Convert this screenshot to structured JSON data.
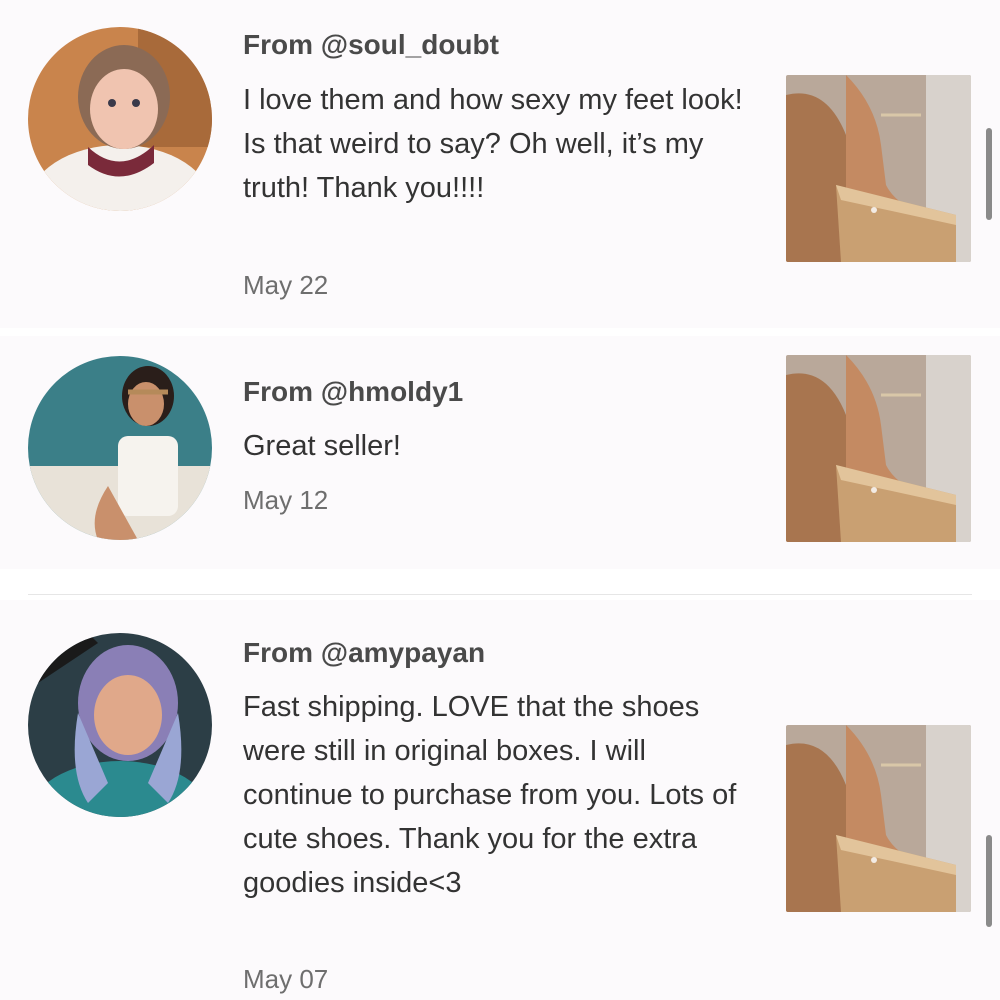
{
  "reviews": [
    {
      "from": "From @soul_doubt",
      "text": "I love them and how sexy my feet look! Is that weird to say? Oh well, it’s my truth! Thank you!!!!",
      "date": "May 22"
    },
    {
      "from": "From @hmoldy1",
      "text": "Great seller!",
      "date": "May 12"
    },
    {
      "from": "From @amypayan",
      "text": "Fast shipping. LOVE that the shoes were still in original boxes. I will continue to purchase from you. Lots of cute shoes. Thank you for the extra goodies inside<3",
      "date": "May 07"
    }
  ],
  "colors": {
    "card_background": "#fcfafc",
    "username_text": "#4a4a4a",
    "body_text": "#333333",
    "date_text": "#6e6e6e"
  },
  "icons": {
    "avatar": "user-profile-photo",
    "product": "cork-wedge-sandal-photo"
  }
}
